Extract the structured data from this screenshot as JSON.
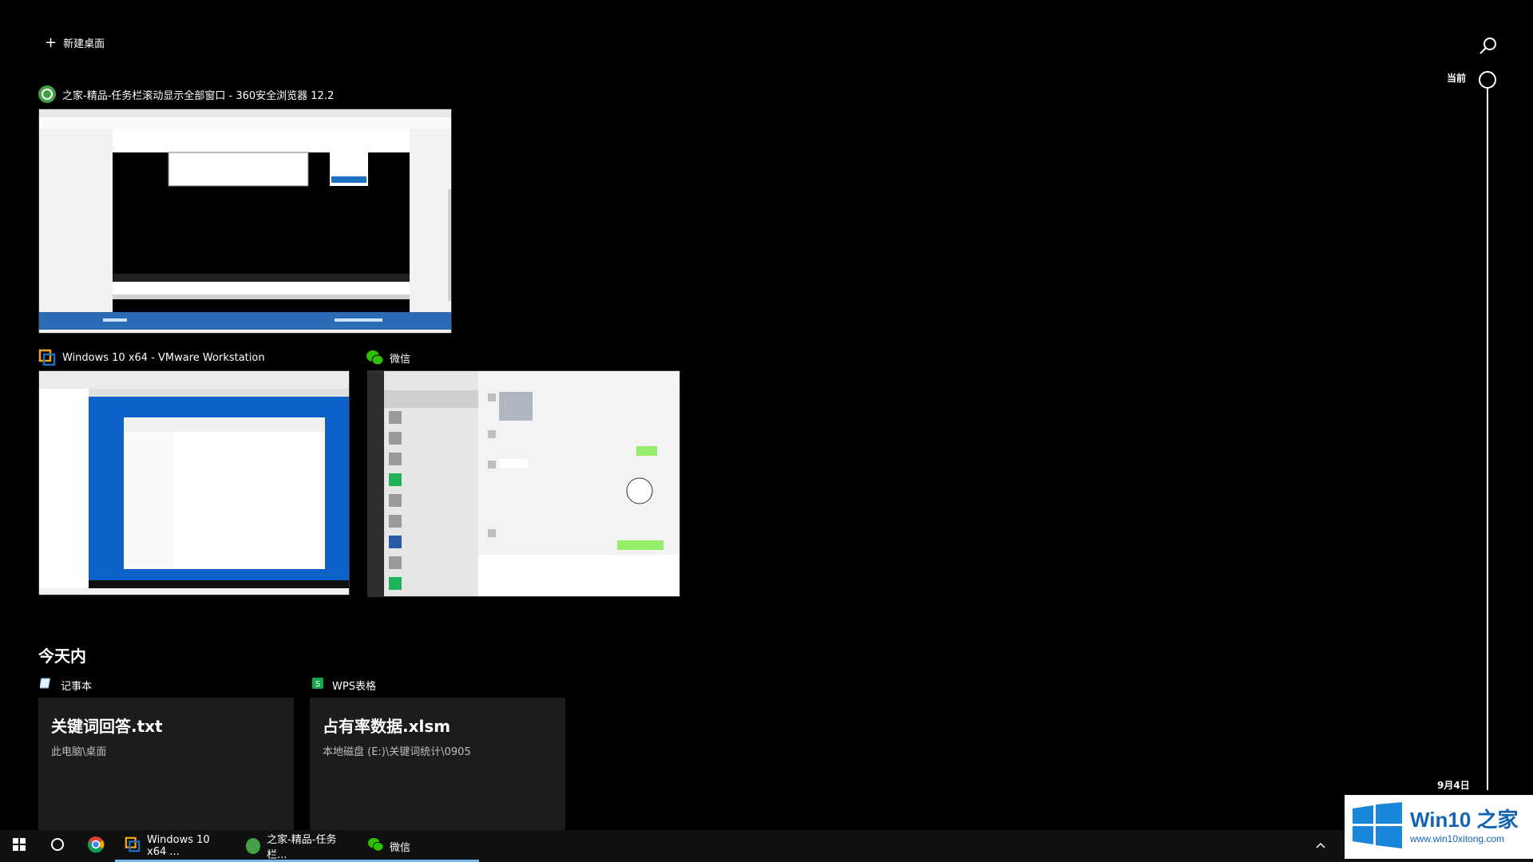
{
  "header": {
    "new_desktop_label": "新建桌面",
    "search_icon": "search-icon"
  },
  "windows": [
    {
      "title": "之家-精品-任务栏滚动显示全部窗口 - 360安全浏览器 12.2",
      "icon": "360-browser-icon"
    },
    {
      "title": "Windows 10 x64 - VMware Workstation",
      "icon": "vmware-icon"
    },
    {
      "title": "微信",
      "icon": "wechat-icon"
    }
  ],
  "timeline": {
    "section_title": "今天内",
    "current_label": "当前",
    "date_label": "9月4日",
    "activities": [
      {
        "app": "记事本",
        "app_icon": "notepad-icon",
        "file": "关键词回答.txt",
        "path": "此电脑\\桌面"
      },
      {
        "app": "WPS表格",
        "app_icon": "wps-spreadsheet-icon",
        "file": "占有率数据.xlsm",
        "path": "本地磁盘 (E:)\\关键词统计\\0905"
      }
    ]
  },
  "taskbar": {
    "apps": [
      {
        "label": "Windows 10 x64 ...",
        "icon": "vmware-icon"
      },
      {
        "label": "之家-精品-任务栏...",
        "icon": "360-browser-icon"
      },
      {
        "label": "微信",
        "icon": "wechat-icon"
      }
    ]
  },
  "watermark": {
    "brand": "Win10 之家",
    "url": "www.win10xitong.com"
  },
  "colors": {
    "accent": "#76b9ed",
    "browser_green": "#43a047",
    "vmware_orange": "#f6a21b",
    "vmware_blue": "#1d72c4",
    "wechat_green": "#2dc100",
    "wps_green": "#11a84b"
  }
}
